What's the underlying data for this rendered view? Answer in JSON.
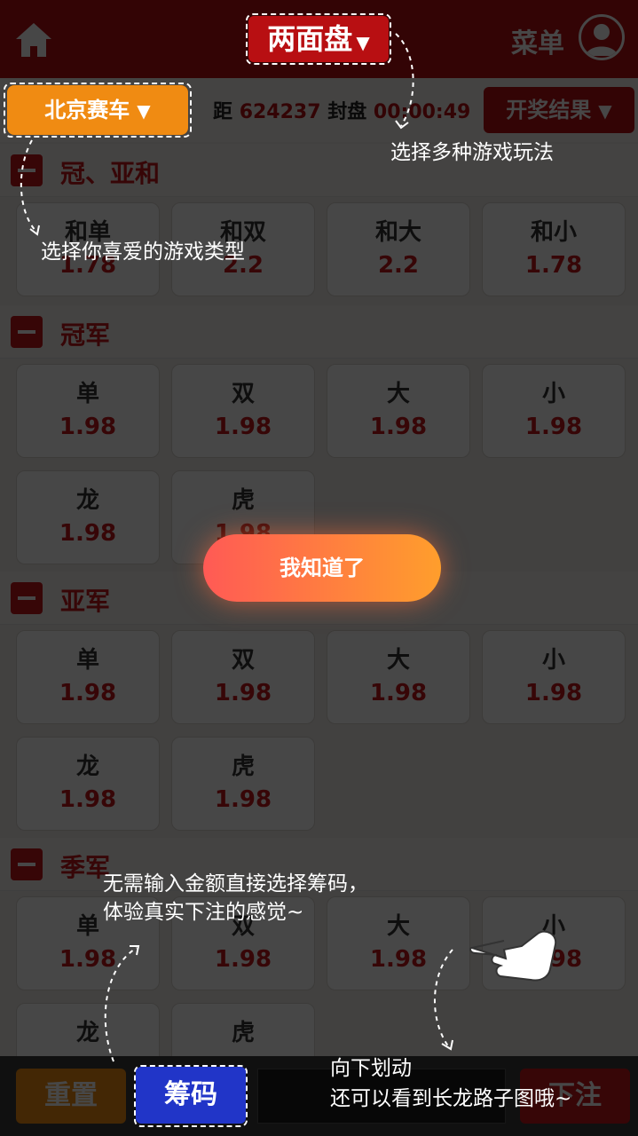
{
  "header": {
    "playtype_label": "两面盘",
    "menu_label": "菜单"
  },
  "subbar": {
    "game_label": "北京赛车",
    "countdown_prefix": "距",
    "issue_number": "624237",
    "countdown_middle": "封盘",
    "countdown_time": "00:00:49",
    "results_label": "开奖结果"
  },
  "sections": [
    {
      "title": "冠、亚和",
      "cells": [
        {
          "name": "和单",
          "odds": "1.78"
        },
        {
          "name": "和双",
          "odds": "2.2"
        },
        {
          "name": "和大",
          "odds": "2.2"
        },
        {
          "name": "和小",
          "odds": "1.78"
        }
      ]
    },
    {
      "title": "冠军",
      "cells": [
        {
          "name": "单",
          "odds": "1.98"
        },
        {
          "name": "双",
          "odds": "1.98"
        },
        {
          "name": "大",
          "odds": "1.98"
        },
        {
          "name": "小",
          "odds": "1.98"
        },
        {
          "name": "龙",
          "odds": "1.98"
        },
        {
          "name": "虎",
          "odds": "1.98"
        }
      ]
    },
    {
      "title": "亚军",
      "cells": [
        {
          "name": "单",
          "odds": "1.98"
        },
        {
          "name": "双",
          "odds": "1.98"
        },
        {
          "name": "大",
          "odds": "1.98"
        },
        {
          "name": "小",
          "odds": "1.98"
        },
        {
          "name": "龙",
          "odds": "1.98"
        },
        {
          "name": "虎",
          "odds": "1.98"
        }
      ]
    },
    {
      "title": "季军",
      "cells": [
        {
          "name": "单",
          "odds": "1.98"
        },
        {
          "name": "双",
          "odds": "1.98"
        },
        {
          "name": "大",
          "odds": "1.98"
        },
        {
          "name": "小",
          "odds": "1.98"
        },
        {
          "name": "龙",
          "odds": ""
        },
        {
          "name": "虎",
          "odds": ""
        }
      ]
    }
  ],
  "bottom": {
    "reset_label": "重置",
    "chip_label": "筹码",
    "submit_label": "下注"
  },
  "guide": {
    "hint_playtype": "选择多种游戏玩法",
    "hint_game": "选择你喜爱的游戏类型",
    "hint_chip_line1": "无需输入金额直接选择筹码，",
    "hint_chip_line2": "体验真实下注的感觉~",
    "hint_scroll_line1": "向下划动",
    "hint_scroll_line2": "还可以看到长龙路子图哦~",
    "confirm_label": "我知道了"
  },
  "colors": {
    "brand_red": "#b80f12",
    "orange": "#f08b12",
    "chip_blue": "#2135c8"
  },
  "icons": [
    "home-icon",
    "user-avatar-icon",
    "caret-down-icon",
    "minus-icon",
    "hand-swipe-icon"
  ]
}
